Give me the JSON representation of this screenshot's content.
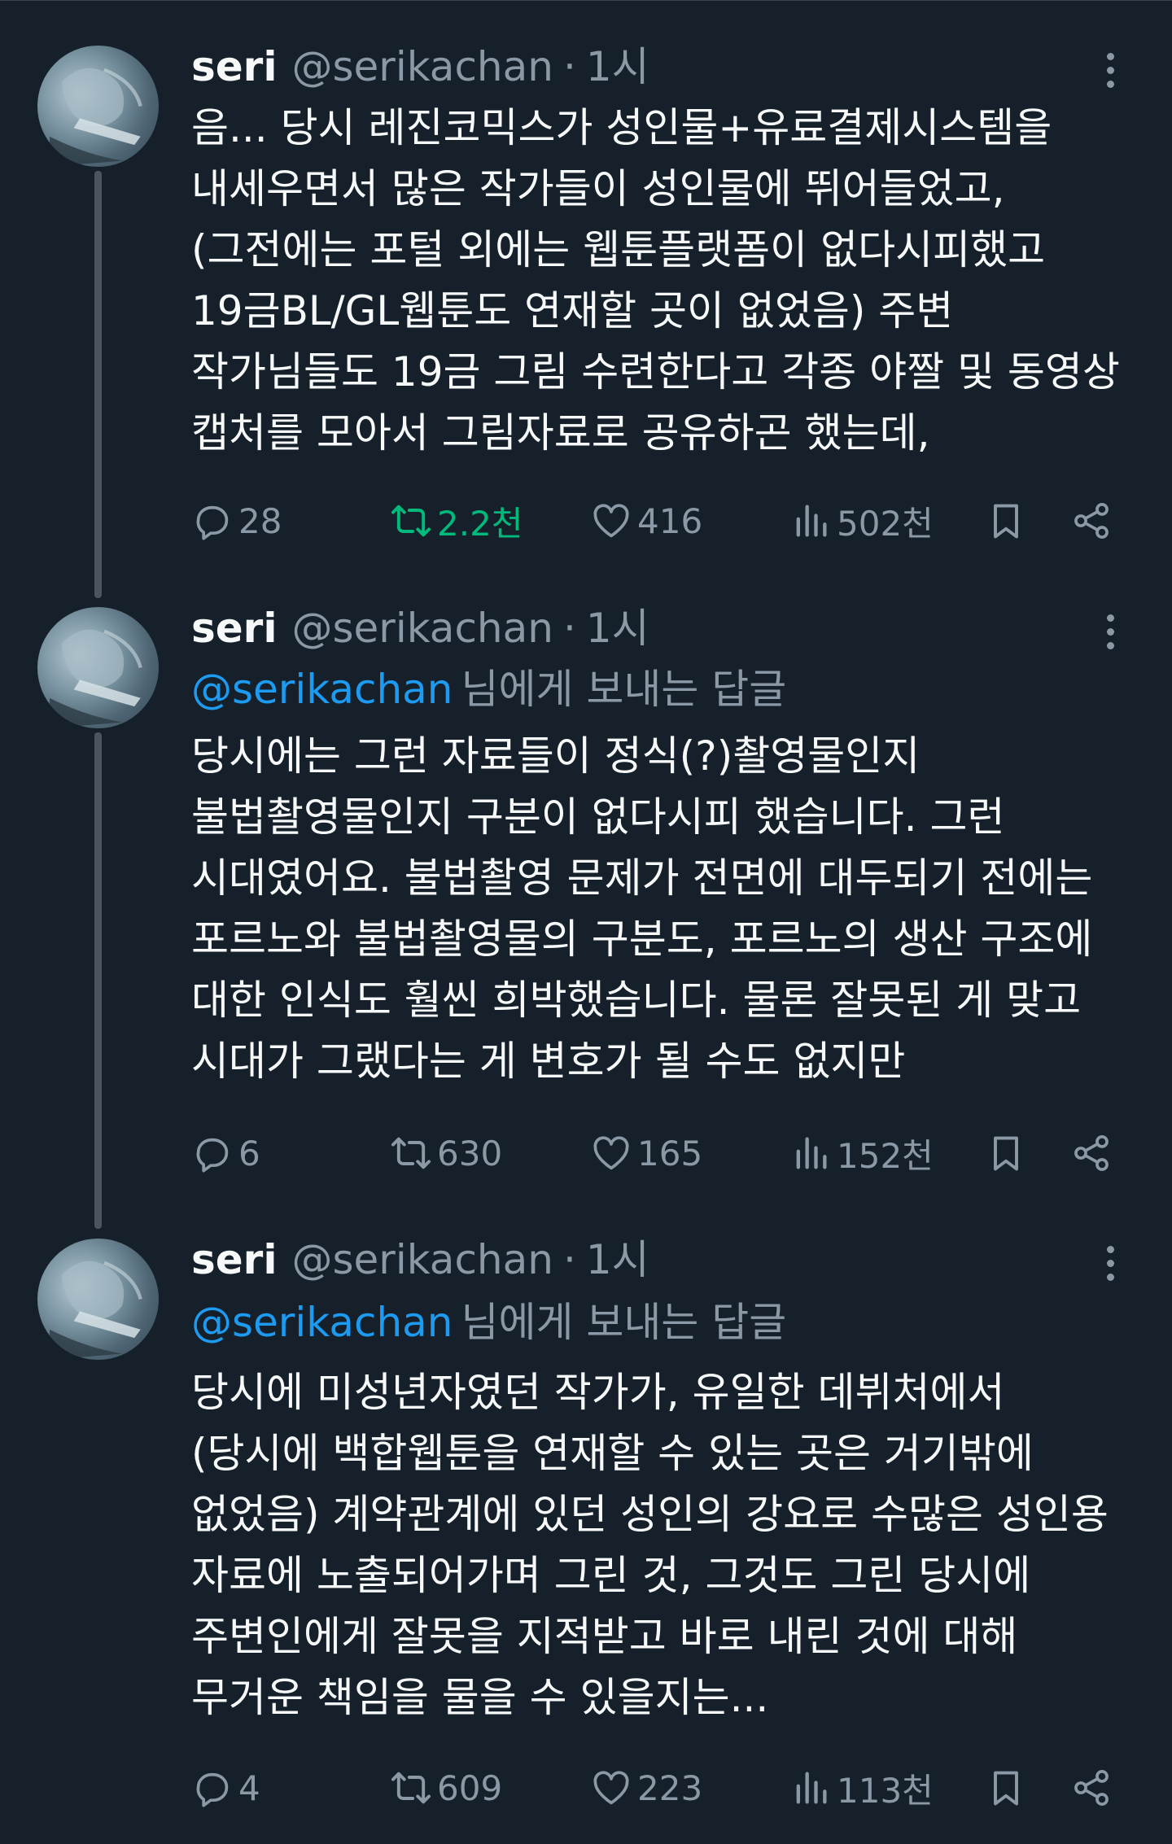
{
  "colors": {
    "background": "#15202b",
    "text": "#f7f9f9",
    "secondary": "#8b98a5",
    "mention": "#1d9bf0",
    "retweet_active": "#00ba7c"
  },
  "tweets": [
    {
      "author": {
        "name": "seri",
        "handle": "@serikachan",
        "separator": "·",
        "time": "1시"
      },
      "reply_to": null,
      "lines": [
        "음... 당시 레진코믹스가 성인물+유료결제시스템을",
        "내세우면서 많은 작가들이 성인물에 뛰어들었고,",
        "(그전에는 포털 외에는 웹툰플랫폼이 없다시피했고",
        "19금BL/GL웹툰도 연재할 곳이 없었음) 주변",
        "작가님들도 19금 그림 수련한다고 각종 야짤 및 동영상",
        "캡처를 모아서 그림자료로 공유하곤 했는데,"
      ],
      "stats": {
        "replies": "28",
        "retweets": "2.2천",
        "likes": "416",
        "views": "502천"
      },
      "retweeted": true
    },
    {
      "author": {
        "name": "seri",
        "handle": "@serikachan",
        "separator": "·",
        "time": "1시"
      },
      "reply_to": {
        "mention": "@serikachan",
        "suffix": "님에게 보내는 답글"
      },
      "lines": [
        "당시에는 그런 자료들이 정식(?)촬영물인지",
        "불법촬영물인지 구분이 없다시피 했습니다. 그런",
        "시대였어요. 불법촬영 문제가 전면에 대두되기 전에는",
        "포르노와 불법촬영물의 구분도, 포르노의 생산 구조에",
        "대한 인식도 훨씬 희박했습니다. 물론 잘못된 게 맞고",
        "시대가 그랬다는 게 변호가 될 수도 없지만"
      ],
      "stats": {
        "replies": "6",
        "retweets": "630",
        "likes": "165",
        "views": "152천"
      },
      "retweeted": false
    },
    {
      "author": {
        "name": "seri",
        "handle": "@serikachan",
        "separator": "·",
        "time": "1시"
      },
      "reply_to": {
        "mention": "@serikachan",
        "suffix": "님에게 보내는 답글"
      },
      "lines": [
        "당시에 미성년자였던 작가가, 유일한 데뷔처에서",
        "(당시에 백합웹툰을 연재할 수 있는 곳은 거기밖에",
        "없었음) 계약관계에 있던 성인의 강요로 수많은 성인용",
        "자료에 노출되어가며 그린 것, 그것도 그린 당시에",
        "주변인에게 잘못을 지적받고 바로 내린 것에 대해",
        "무거운 책임을 물을 수 있을지는..."
      ],
      "stats": {
        "replies": "4",
        "retweets": "609",
        "likes": "223",
        "views": "113천"
      },
      "retweeted": false
    }
  ]
}
